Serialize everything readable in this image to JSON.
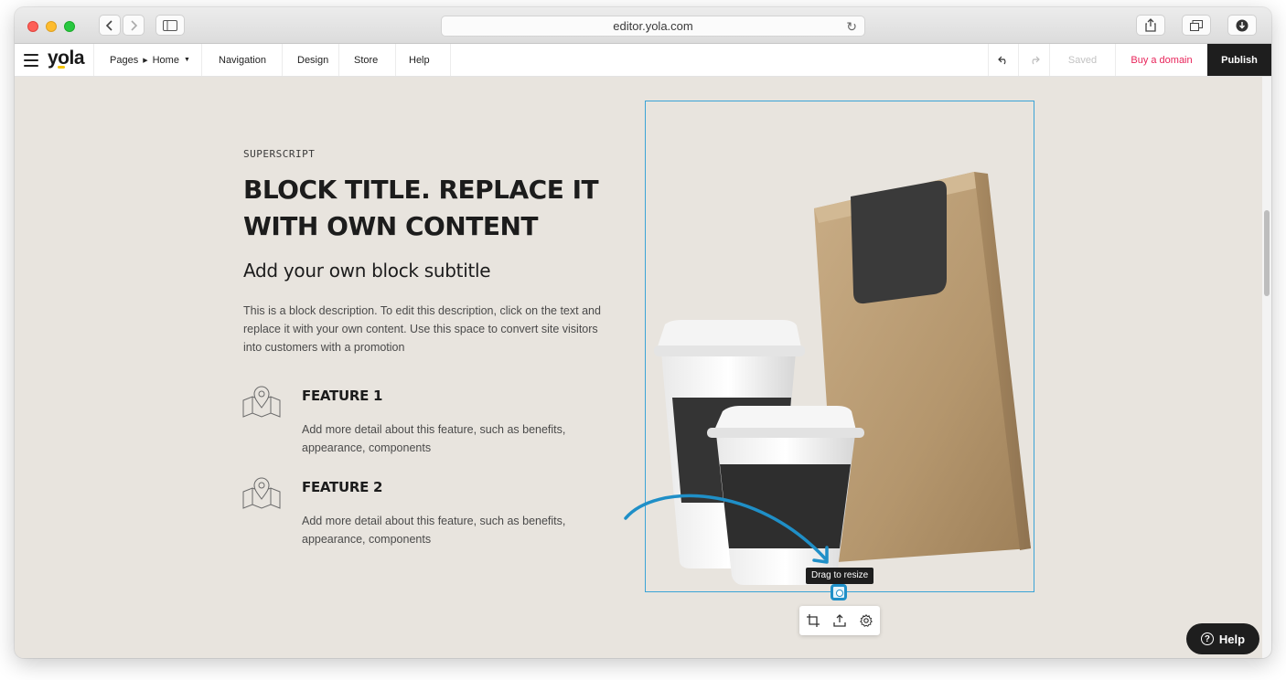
{
  "browser": {
    "url": "editor.yola.com"
  },
  "toolbar": {
    "logo": "yola",
    "pages_label": "Pages",
    "pages_current": "Home",
    "navigation_label": "Navigation",
    "design_label": "Design",
    "store_label": "Store",
    "help_label": "Help",
    "saved_label": "Saved",
    "buy_domain_label": "Buy a domain",
    "publish_label": "Publish"
  },
  "block": {
    "superscript": "SUPERSCRIPT",
    "title": "BLOCK TITLE. REPLACE IT WITH OWN CONTENT",
    "subtitle": "Add your own block subtitle",
    "description": "This is a block description. To edit this description, click on the text and replace it with your own content. Use this space to convert site visitors into customers with a promotion",
    "features": [
      {
        "title": "FEATURE 1",
        "description": "Add more detail about this feature, such as benefits, appearance, components"
      },
      {
        "title": "FEATURE 2",
        "description": "Add more detail about this feature, such as benefits, appearance, components"
      }
    ]
  },
  "image_editor": {
    "tooltip": "Drag to resize"
  },
  "help_button": {
    "label": "Help"
  },
  "colors": {
    "accent": "#3aa3d6",
    "buy_domain": "#e8245a",
    "publish_bg": "#1e1e1e",
    "page_bg": "#e8e4de"
  },
  "icons": [
    "back-icon",
    "forward-icon",
    "sidebar-icon",
    "reload-icon",
    "share-icon",
    "tabs-icon",
    "download-icon",
    "hamburger-icon",
    "undo-icon",
    "redo-icon",
    "map-pin-icon",
    "crop-icon",
    "upload-icon",
    "gear-icon",
    "help-circle-icon"
  ]
}
